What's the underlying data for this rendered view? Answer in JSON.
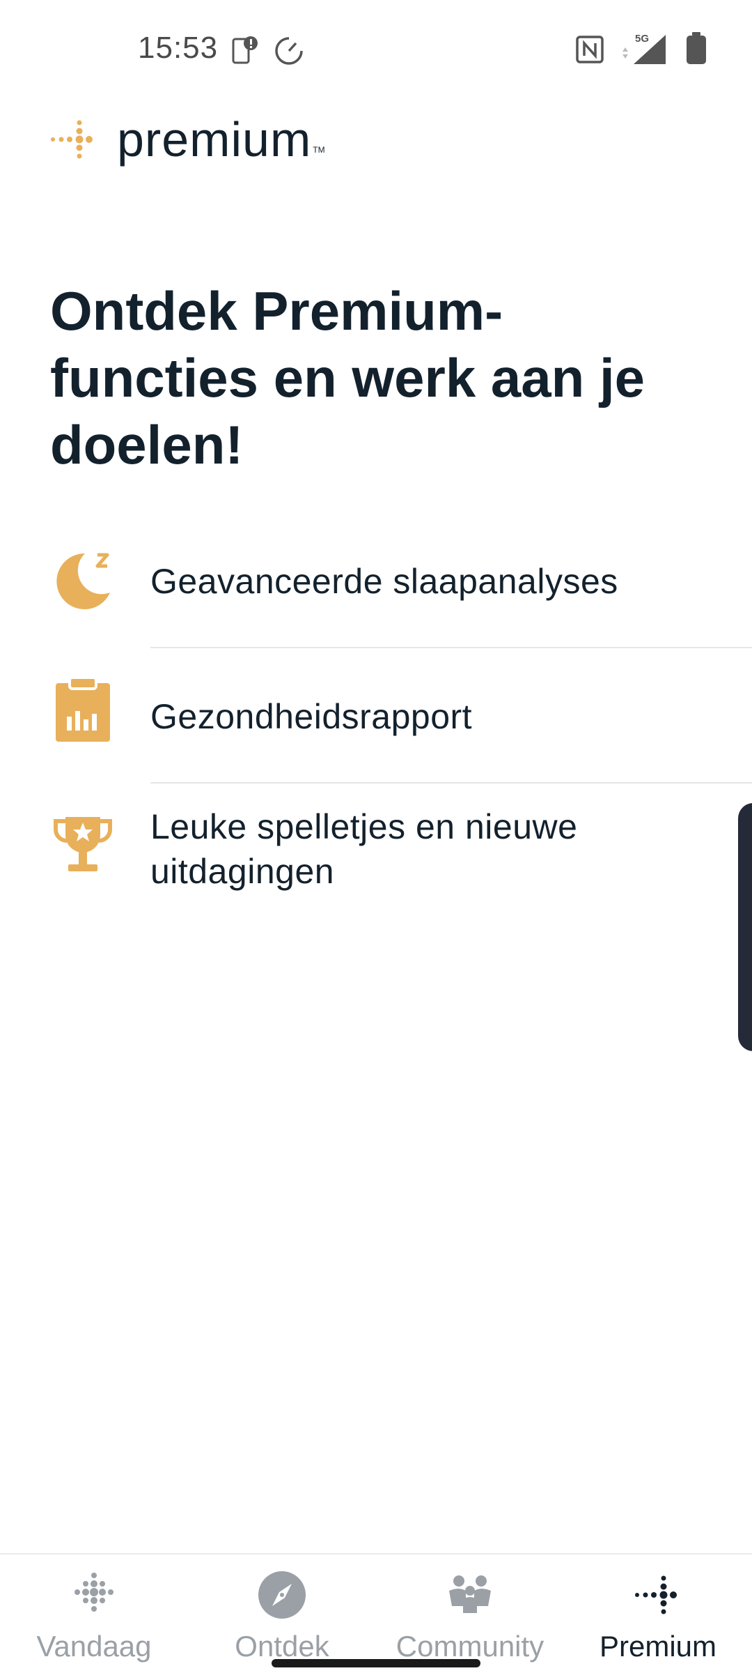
{
  "status_bar": {
    "time": "15:53",
    "network": "5G"
  },
  "logo": {
    "text": "premium",
    "tm": "TM"
  },
  "headline": "Ontdek Premium-functies en werk aan je doelen!",
  "features": [
    {
      "icon": "moon-sleep-icon",
      "label": "Geavanceerde slaapanalyses"
    },
    {
      "icon": "clipboard-chart-icon",
      "label": "Gezondheidsrapport"
    },
    {
      "icon": "trophy-icon",
      "label": "Leuke spelletjes en nieuwe uitdagingen"
    }
  ],
  "bottom_nav": [
    {
      "icon": "dots-grid-icon",
      "label": "Vandaag",
      "active": false
    },
    {
      "icon": "compass-icon",
      "label": "Ontdek",
      "active": false
    },
    {
      "icon": "people-icon",
      "label": "Community",
      "active": false
    },
    {
      "icon": "premium-dots-icon",
      "label": "Premium",
      "active": true
    }
  ],
  "colors": {
    "accent": "#E8B05A",
    "text": "#13212D",
    "inactive": "#9AA0A6"
  }
}
